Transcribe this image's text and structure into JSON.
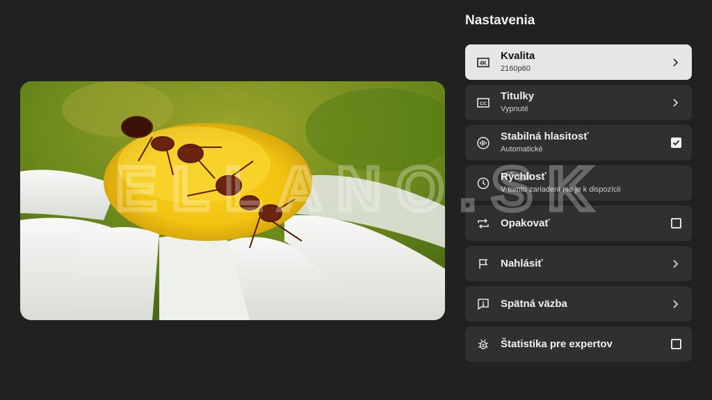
{
  "settings": {
    "title": "Nastavenia",
    "items": [
      {
        "label": "Kvalita",
        "sub": "2160p60",
        "icon": "4k-icon",
        "trailing": "chevron",
        "selected": true
      },
      {
        "label": "Titulky",
        "sub": "Vypnuté",
        "icon": "cc-icon",
        "trailing": "chevron"
      },
      {
        "label": "Stabilná hlasitosť",
        "sub": "Automatické",
        "icon": "volume-wave-icon",
        "trailing": "checkbox",
        "checked": true
      },
      {
        "label": "Rýchlosť",
        "sub": "V tomto zariadení nie je k dispozícii",
        "icon": "speed-icon",
        "trailing": "none"
      },
      {
        "label": "Opakovať",
        "sub": "",
        "icon": "repeat-icon",
        "trailing": "checkbox",
        "checked": false
      },
      {
        "label": "Nahlásiť",
        "sub": "",
        "icon": "flag-icon",
        "trailing": "chevron"
      },
      {
        "label": "Spätná väzba",
        "sub": "",
        "icon": "feedback-icon",
        "trailing": "chevron"
      },
      {
        "label": "Štatistika pre expertov",
        "sub": "",
        "icon": "bug-icon",
        "trailing": "checkbox",
        "checked": false
      }
    ]
  },
  "watermark": {
    "text": "ELLANO.SK"
  },
  "colors": {
    "background": "#212121",
    "item": "#303030",
    "selected": "#e6e6e6",
    "text": "#f1f1f1"
  }
}
